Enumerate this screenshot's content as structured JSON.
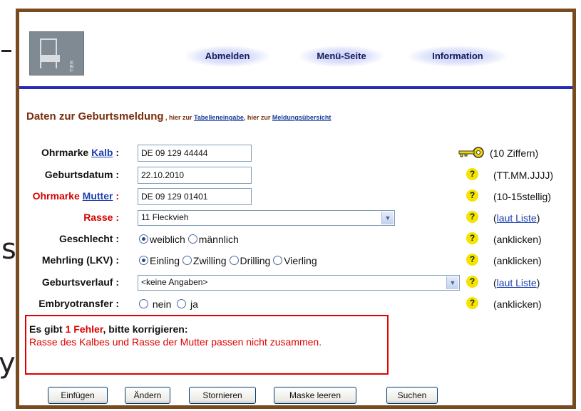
{
  "logo": {
    "side_text": "TIER"
  },
  "nav": {
    "logout": "Abmelden",
    "menu": "Menü-Seite",
    "info": "Information"
  },
  "heading": {
    "title": "Daten zur Geburtsmeldung",
    "sep1": " , hier zur ",
    "link1": "Tabelleneingabe",
    "sep2": ", hier zur ",
    "link2": "Meldungsübersicht"
  },
  "form": {
    "ohrmarke_kalb": {
      "label_pre": "Ohrmarke ",
      "label_link": "Kalb",
      "colon": " :",
      "value": "DE 09 129 44444",
      "hint": "(10 Ziffern)"
    },
    "geburtsdatum": {
      "label": "Geburtsdatum :",
      "value": "22.10.2010",
      "hint": "(TT.MM.JJJJ)"
    },
    "ohrmarke_mutter": {
      "label_pre": "Ohrmarke ",
      "label_link": "Mutter",
      "colon": " :",
      "value": "DE 09 129 01401",
      "hint": "(10-15stellig)"
    },
    "rasse": {
      "label": "Rasse :",
      "value": "11 Fleckvieh",
      "hint_link": "laut Liste"
    },
    "geschlecht": {
      "label": "Geschlecht :",
      "options": [
        "weiblich",
        "männlich"
      ],
      "selected": 0,
      "hint": "(anklicken)"
    },
    "mehrling": {
      "label": "Mehrling (LKV) :",
      "options": [
        "Einling",
        "Zwilling",
        "Drilling",
        "Vierling"
      ],
      "selected": 0,
      "hint": "(anklicken)"
    },
    "geburtsverlauf": {
      "label": "Geburtsverlauf :",
      "value": "<keine Angaben>",
      "hint_link": "laut Liste"
    },
    "embryotransfer": {
      "label": "Embryotransfer :",
      "options": [
        "nein",
        "ja"
      ],
      "selected": -1,
      "hint": "(anklicken)"
    }
  },
  "help_glyph": "?",
  "error": {
    "pre": "Es gibt ",
    "count": "1 Fehler",
    "post": ", bitte korrigieren:",
    "message": "Rasse des Kalbes und Rasse der Mutter passen nicht zusammen."
  },
  "buttons": {
    "insert": "Einfügen",
    "change": "Ändern",
    "cancel": "Stornieren",
    "clear": "Maske leeren",
    "search": "Suchen"
  },
  "background_letters": {
    "a": "s",
    "b": "y"
  },
  "colors": {
    "frame": "#7a4a1f",
    "rule": "#2a2ab8",
    "error": "#e00000",
    "link": "#1a3fb0"
  }
}
